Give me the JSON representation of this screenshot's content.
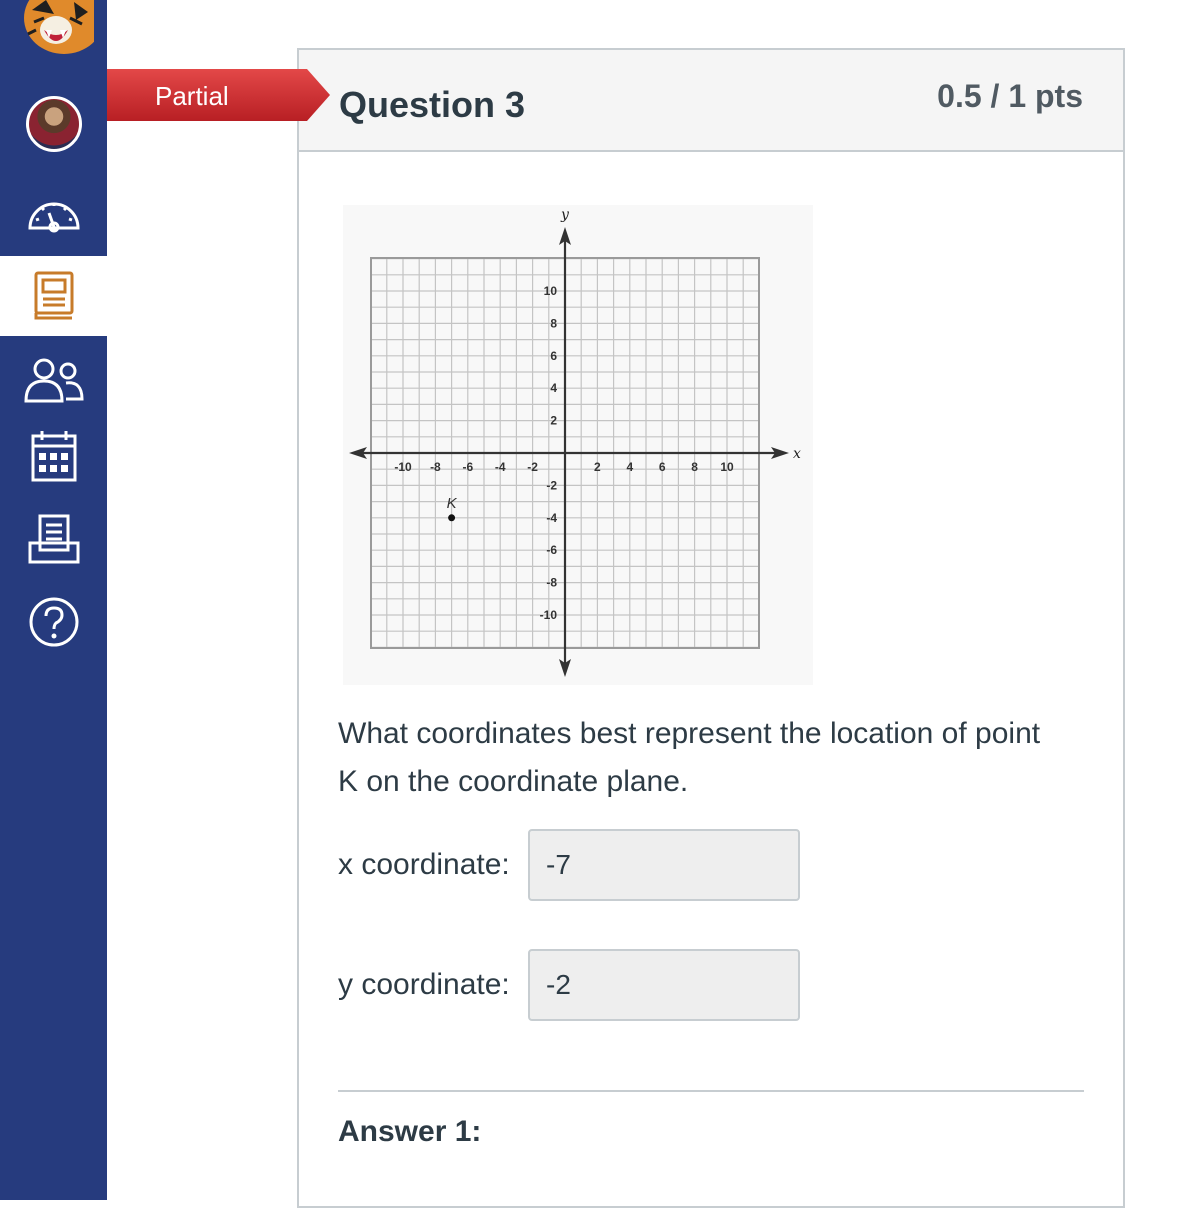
{
  "nav": {
    "items": [
      {
        "name": "account-avatar"
      },
      {
        "name": "dashboard-icon"
      },
      {
        "name": "courses-icon",
        "active": true
      },
      {
        "name": "groups-icon"
      },
      {
        "name": "calendar-icon"
      },
      {
        "name": "inbox-icon"
      },
      {
        "name": "help-icon"
      }
    ],
    "bg": "#263b7e",
    "active_icon_color": "#c77b2a"
  },
  "ribbon": {
    "label": "Partial",
    "color": "#d63a3a"
  },
  "question": {
    "title": "Question 3",
    "points": "0.5 / 1 pts",
    "text": "What coordinates best represent the location of point K on the coordinate plane.",
    "fields": [
      {
        "label": "x coordinate:",
        "value": "-7"
      },
      {
        "label": "y coordinate:",
        "value": "-2"
      }
    ],
    "answer_label": "Answer 1:"
  },
  "graph": {
    "x_axis_label": "x",
    "y_axis_label": "y",
    "x_ticks": [
      {
        "v": -10,
        "t": "-10"
      },
      {
        "v": -8,
        "t": "-8"
      },
      {
        "v": -6,
        "t": "-6"
      },
      {
        "v": -4,
        "t": "-4"
      },
      {
        "v": -2,
        "t": "-2"
      },
      {
        "v": 2,
        "t": "2"
      },
      {
        "v": 4,
        "t": "4"
      },
      {
        "v": 6,
        "t": "6"
      },
      {
        "v": 8,
        "t": "8"
      },
      {
        "v": 10,
        "t": "10"
      }
    ],
    "y_ticks": [
      {
        "v": 10,
        "t": "10"
      },
      {
        "v": 8,
        "t": "8"
      },
      {
        "v": 6,
        "t": "6"
      },
      {
        "v": 4,
        "t": "4"
      },
      {
        "v": 2,
        "t": "2"
      },
      {
        "v": -2,
        "t": "-2"
      },
      {
        "v": -4,
        "t": "-4"
      },
      {
        "v": -6,
        "t": "-6"
      },
      {
        "v": -8,
        "t": "-8"
      },
      {
        "v": -10,
        "t": "-10"
      }
    ],
    "range": [
      -12,
      12
    ],
    "point": {
      "label": "K",
      "x": -7,
      "y": -4
    }
  }
}
